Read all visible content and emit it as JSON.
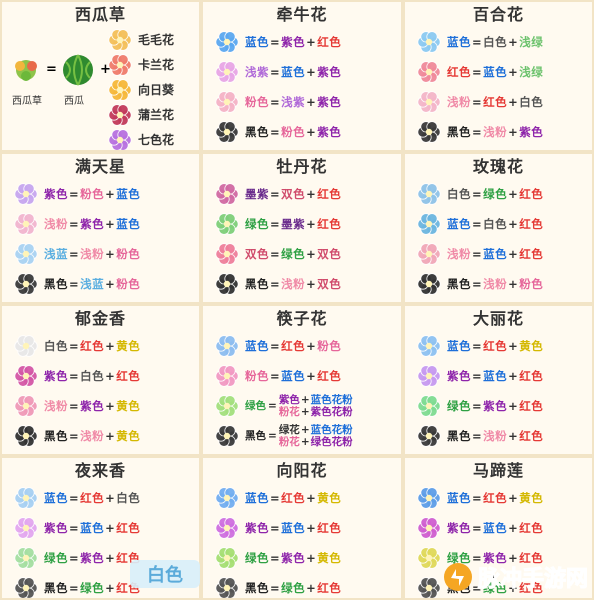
{
  "colors": {
    "红色": "#e53935",
    "紫色": "#8e24aa",
    "蓝色": "#1e6fd9",
    "白色": "#555555",
    "黑色": "#222222",
    "粉色": "#e6669a",
    "浅紫": "#b06ad8",
    "浅粉": "#f08aa7",
    "浅绿": "#6cc26c",
    "浅蓝": "#5aaee0",
    "黄色": "#d4b800",
    "绿色": "#2ea043",
    "墨紫": "#6a2b8c",
    "双色": "#d04b6b",
    "op": "#333333"
  },
  "panels": [
    {
      "key": "xigua",
      "title": "西瓜草",
      "type": "watermelon",
      "base_a": "西瓜草",
      "base_b": "西瓜",
      "items": [
        {
          "name": "毛毛花",
          "icon": "pom-flower-icon"
        },
        {
          "name": "卡兰花",
          "icon": "kalan-flower-icon"
        },
        {
          "name": "向日葵",
          "icon": "sunflower-icon"
        },
        {
          "name": "蒲兰花",
          "icon": "radish-flower-icon"
        },
        {
          "name": "七色花",
          "icon": "rainbow-flower-icon"
        }
      ]
    },
    {
      "key": "qianniu",
      "title": "牵牛花",
      "rows": [
        {
          "flower": "#5ba8f0",
          "a": "蓝色",
          "b": "紫色",
          "c": "红色"
        },
        {
          "flower": "#e8a6e6",
          "a": "浅紫",
          "b": "蓝色",
          "c": "紫色"
        },
        {
          "flower": "#f5b3c6",
          "a": "粉色",
          "b": "浅紫",
          "c": "紫色"
        },
        {
          "flower": "#3a3a3a",
          "a": "黑色",
          "b": "粉色",
          "c": "紫色"
        }
      ]
    },
    {
      "key": "baihe",
      "title": "百合花",
      "rows": [
        {
          "flower": "#8ccaf2",
          "a": "蓝色",
          "b": "白色",
          "c": "浅绿"
        },
        {
          "flower": "#f08a9a",
          "a": "红色",
          "b": "蓝色",
          "c": "浅绿"
        },
        {
          "flower": "#f4b6c9",
          "a": "浅粉",
          "b": "红色",
          "c": "白色"
        },
        {
          "flower": "#3a3a3a",
          "a": "黑色",
          "b": "浅粉",
          "c": "紫色"
        }
      ]
    },
    {
      "key": "mantian",
      "title": "满天星",
      "rows": [
        {
          "flower": "#c7a6ef",
          "a": "紫色",
          "b": "粉色",
          "c": "蓝色"
        },
        {
          "flower": "#f2b5cf",
          "a": "浅粉",
          "b": "紫色",
          "c": "蓝色"
        },
        {
          "flower": "#a9d3f3",
          "a": "浅蓝",
          "b": "浅粉",
          "c": "粉色"
        },
        {
          "flower": "#3b3b3b",
          "a": "黑色",
          "b": "浅蓝",
          "c": "粉色"
        }
      ]
    },
    {
      "key": "mudan",
      "title": "牡丹花",
      "rows": [
        {
          "flower": "#d16aa3",
          "a": "墨紫",
          "b": "双色",
          "c": "红色"
        },
        {
          "flower": "#7fcf7a",
          "a": "绿色",
          "b": "墨紫",
          "c": "红色"
        },
        {
          "flower": "#ef7f9b",
          "a": "双色",
          "b": "绿色",
          "c": "双色"
        },
        {
          "flower": "#333333",
          "a": "黑色",
          "b": "浅粉",
          "c": "双色"
        }
      ]
    },
    {
      "key": "meigui",
      "title": "玫瑰花",
      "rows": [
        {
          "flower": "#8fc3e8",
          "a": "白色",
          "b": "绿色",
          "c": "红色"
        },
        {
          "flower": "#6cb6e0",
          "a": "蓝色",
          "b": "白色",
          "c": "红色"
        },
        {
          "flower": "#f1a7b8",
          "a": "浅粉",
          "b": "蓝色",
          "c": "红色"
        },
        {
          "flower": "#333333",
          "a": "黑色",
          "b": "浅粉",
          "c": "粉色"
        }
      ]
    },
    {
      "key": "yujin",
      "title": "郁金香",
      "rows": [
        {
          "flower": "#e8e8e8",
          "a": "白色",
          "b": "红色",
          "c": "黄色"
        },
        {
          "flower": "#d457a6",
          "a": "紫色",
          "b": "白色",
          "c": "红色"
        },
        {
          "flower": "#f09ab8",
          "a": "浅粉",
          "b": "紫色",
          "c": "黄色"
        },
        {
          "flower": "#333333",
          "a": "黑色",
          "b": "浅粉",
          "c": "黄色"
        }
      ]
    },
    {
      "key": "shaizi",
      "title": "筷子花",
      "rows": [
        {
          "flower": "#8dbdf0",
          "a": "蓝色",
          "b": "红色",
          "c": "粉色"
        },
        {
          "flower": "#f29ac3",
          "a": "粉色",
          "b": "蓝色",
          "c": "红色"
        },
        {
          "flower": "#a4e07e",
          "a": "绿色",
          "complex": true,
          "top": [
            "紫色",
            "蓝色花粉"
          ],
          "bottom": [
            "粉花",
            "紫色花粉"
          ]
        },
        {
          "flower": "#3b3b3b",
          "a": "黑色",
          "complex": true,
          "top": [
            "绿花",
            "蓝色花粉"
          ],
          "bottom": [
            "粉花",
            "绿色花粉"
          ]
        }
      ]
    },
    {
      "key": "dali",
      "title": "大丽花",
      "rows": [
        {
          "flower": "#8ec2f2",
          "a": "蓝色",
          "b": "红色",
          "c": "黄色"
        },
        {
          "flower": "#c79af0",
          "a": "紫色",
          "b": "蓝色",
          "c": "红色"
        },
        {
          "flower": "#7fdc92",
          "a": "绿色",
          "b": "紫色",
          "c": "红色"
        },
        {
          "flower": "#3a3a3a",
          "a": "黑色",
          "b": "浅粉",
          "c": "红色"
        }
      ]
    },
    {
      "key": "yelai",
      "title": "夜来香",
      "rows": [
        {
          "flower": "#a7d0f3",
          "a": "蓝色",
          "b": "红色",
          "c": "白色"
        },
        {
          "flower": "#e3a7ef",
          "a": "紫色",
          "b": "蓝色",
          "c": "红色"
        },
        {
          "flower": "#a5dfa1",
          "a": "绿色",
          "b": "紫色",
          "c": "红色"
        },
        {
          "flower": "#555555",
          "a": "黑色",
          "b": "绿色",
          "c": "红色"
        }
      ]
    },
    {
      "key": "xiangyang",
      "title": "向阳花",
      "rows": [
        {
          "flower": "#72aef0",
          "a": "蓝色",
          "b": "红色",
          "c": "黄色"
        },
        {
          "flower": "#cf6fe0",
          "a": "紫色",
          "b": "蓝色",
          "c": "红色"
        },
        {
          "flower": "#a6df73",
          "a": "绿色",
          "b": "紫色",
          "c": "黄色"
        },
        {
          "flower": "#555555",
          "a": "黑色",
          "b": "绿色",
          "c": "红色"
        }
      ]
    },
    {
      "key": "mati",
      "title": "马蹄莲",
      "rows": [
        {
          "flower": "#5d9ee8",
          "a": "蓝色",
          "b": "红色",
          "c": "黄色"
        },
        {
          "flower": "#d05fd0",
          "a": "紫色",
          "b": "蓝色",
          "c": "红色"
        },
        {
          "flower": "#e0d95a",
          "a": "绿色",
          "b": "紫色",
          "c": "红色"
        },
        {
          "flower": "#555555",
          "a": "黑色",
          "b": "绿色",
          "c": "红色"
        }
      ]
    }
  ],
  "watermark": {
    "badge": "白色",
    "brand": "脉冲手游网"
  }
}
